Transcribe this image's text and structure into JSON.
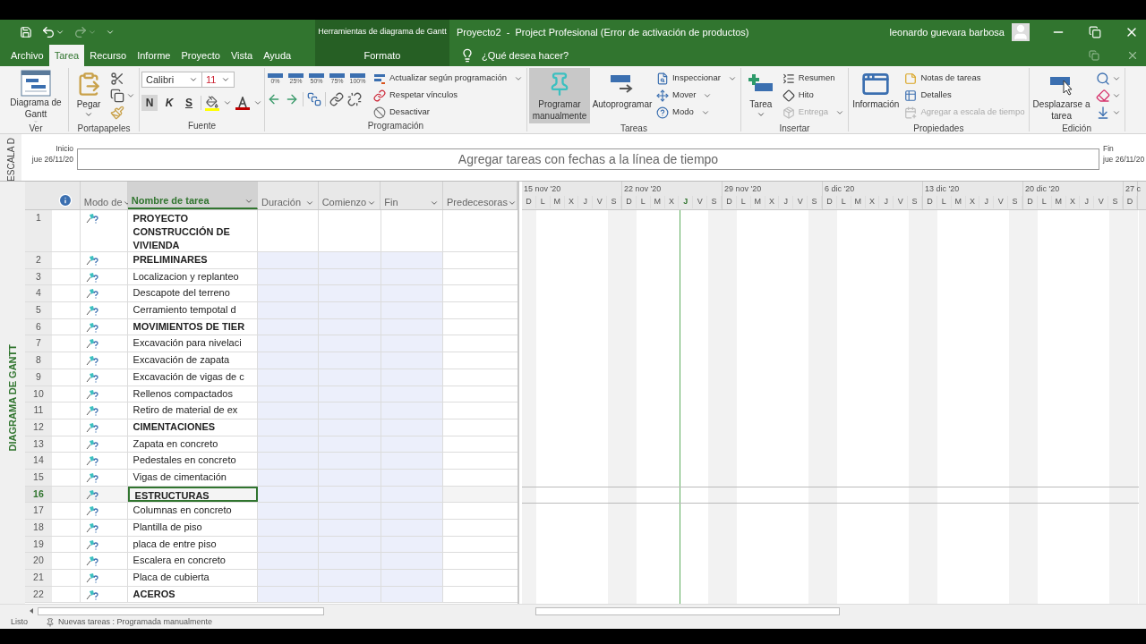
{
  "title_bar": {
    "context_group": "Herramientas de diagrama de Gantt",
    "title": "Proyecto2  -  Project Profesional (Error de activación de productos)",
    "user": "leonardo guevara barbosa"
  },
  "tabs": [
    {
      "label": "Archivo",
      "selected": false,
      "kind": "normal"
    },
    {
      "label": "Tarea",
      "selected": true,
      "kind": "normal"
    },
    {
      "label": "Recurso",
      "selected": false,
      "kind": "normal"
    },
    {
      "label": "Informe",
      "selected": false,
      "kind": "normal"
    },
    {
      "label": "Proyecto",
      "selected": false,
      "kind": "normal"
    },
    {
      "label": "Vista",
      "selected": false,
      "kind": "normal"
    },
    {
      "label": "Ayuda",
      "selected": false,
      "kind": "normal"
    },
    {
      "label": "Formato",
      "selected": false,
      "kind": "contextual"
    }
  ],
  "tell_me": {
    "placeholder": "¿Qué desea hacer?"
  },
  "ribbon_groups": [
    {
      "label": "Ver",
      "items": [
        {
          "kind": "large",
          "label": "Diagrama de Gantt",
          "dropdown": true,
          "selected": false,
          "disabled": false
        }
      ]
    },
    {
      "label": "Portapapeles",
      "items": [
        {
          "kind": "large",
          "label": "Pegar",
          "dropdown": true,
          "selected": false,
          "disabled": false
        },
        {
          "kind": "icon",
          "dropdown": false,
          "disabled": false
        },
        {
          "kind": "icon",
          "dropdown": true,
          "disabled": false
        },
        {
          "kind": "icon",
          "dropdown": false,
          "disabled": false
        }
      ]
    },
    {
      "label": "Fuente",
      "items": [
        {
          "kind": "font",
          "font": "Calibri",
          "size": "11",
          "bold": "N",
          "italic": "K",
          "underline": "S"
        }
      ]
    },
    {
      "label": "Programación",
      "items": [
        {
          "kind": "percents",
          "labels": [
            "0%",
            "25%",
            "50%",
            "75%",
            "100%"
          ]
        },
        {
          "kind": "small",
          "label": "Actualizar según programación",
          "dropdown": true,
          "disabled": false
        },
        {
          "kind": "small",
          "label": "Respetar vínculos",
          "dropdown": false,
          "disabled": false
        },
        {
          "kind": "small",
          "label": "Desactivar",
          "dropdown": false,
          "disabled": false
        }
      ]
    },
    {
      "label": "Tareas",
      "items": [
        {
          "kind": "large",
          "label": "Programar manualmente",
          "dropdown": false,
          "selected": true,
          "disabled": false
        },
        {
          "kind": "large",
          "label": "Autoprogramar",
          "dropdown": false,
          "selected": false,
          "disabled": false
        },
        {
          "kind": "small",
          "label": "Inspeccionar",
          "dropdown": true,
          "disabled": false
        },
        {
          "kind": "small",
          "label": "Mover",
          "dropdown": true,
          "disabled": false
        },
        {
          "kind": "small",
          "label": "Modo",
          "dropdown": true,
          "disabled": false
        }
      ]
    },
    {
      "label": "Insertar",
      "items": [
        {
          "kind": "large",
          "label": "Tarea",
          "dropdown": true,
          "selected": false,
          "disabled": false
        },
        {
          "kind": "small",
          "label": "Resumen",
          "dropdown": false,
          "disabled": false
        },
        {
          "kind": "small",
          "label": "Hito",
          "dropdown": false,
          "disabled": false
        },
        {
          "kind": "small",
          "label": "Entrega",
          "dropdown": true,
          "disabled": true
        }
      ]
    },
    {
      "label": "Propiedades",
      "items": [
        {
          "kind": "large",
          "label": "Información",
          "dropdown": false,
          "selected": false,
          "disabled": false
        },
        {
          "kind": "small",
          "label": "Notas de tareas",
          "dropdown": false,
          "disabled": false
        },
        {
          "kind": "small",
          "label": "Detalles",
          "dropdown": false,
          "disabled": false
        },
        {
          "kind": "small",
          "label": "Agregar a escala de tiempo",
          "dropdown": false,
          "disabled": true
        }
      ]
    },
    {
      "label": "Edición",
      "items": [
        {
          "kind": "large",
          "label": "Desplazarse a tarea",
          "dropdown": false,
          "selected": false,
          "disabled": false
        },
        {
          "kind": "icon",
          "dropdown": true,
          "disabled": false
        },
        {
          "kind": "icon",
          "dropdown": true,
          "disabled": false
        },
        {
          "kind": "icon",
          "dropdown": true,
          "disabled": false
        }
      ]
    }
  ],
  "timeline": {
    "side_label": "ESCALA D",
    "start_label": "Inicio",
    "start_date": "jue 26/11/20",
    "placeholder": "Agregar tareas con fechas a la línea de tiempo",
    "end_label": "Fin",
    "end_date": "jue 26/11/20"
  },
  "view_label": "DIAGRAMA DE GANTT",
  "table": {
    "columns": [
      {
        "kind": "info",
        "selected": false
      },
      {
        "kind": "text",
        "label": "Modo de",
        "selected": false
      },
      {
        "kind": "text",
        "label": "Nombre de tarea",
        "selected": true
      },
      {
        "kind": "text",
        "label": "Duración",
        "selected": false
      },
      {
        "kind": "text",
        "label": "Comienzo",
        "selected": false
      },
      {
        "kind": "text",
        "label": "Fin",
        "selected": false
      },
      {
        "kind": "text",
        "label": "Predecesoras",
        "selected": false
      }
    ],
    "rows": [
      {
        "id": "1",
        "name": "PROYECTO CONSTRUCCIÓN DE VIVIENDA",
        "kind": "summary",
        "shaded": false,
        "selected": false
      },
      {
        "id": "2",
        "name": "PRELIMINARES",
        "kind": "summary",
        "shaded": true,
        "selected": false
      },
      {
        "id": "3",
        "name": "Localizacion y replanteo",
        "kind": "task",
        "shaded": true,
        "selected": false
      },
      {
        "id": "4",
        "name": "Descapote del terreno",
        "kind": "task",
        "shaded": true,
        "selected": false
      },
      {
        "id": "5",
        "name": "Cerramiento tempotal d",
        "kind": "task",
        "shaded": true,
        "selected": false
      },
      {
        "id": "6",
        "name": "MOVIMIENTOS DE TIER",
        "kind": "summary",
        "shaded": true,
        "selected": false
      },
      {
        "id": "7",
        "name": "Excavación para nivelaci",
        "kind": "task",
        "shaded": true,
        "selected": false
      },
      {
        "id": "8",
        "name": "Excavación de zapata",
        "kind": "task",
        "shaded": true,
        "selected": false
      },
      {
        "id": "9",
        "name": "Excavación de vigas de c",
        "kind": "task",
        "shaded": true,
        "selected": false
      },
      {
        "id": "10",
        "name": "Rellenos compactados",
        "kind": "task",
        "shaded": true,
        "selected": false
      },
      {
        "id": "11",
        "name": "Retiro de material de ex",
        "kind": "task",
        "shaded": true,
        "selected": false
      },
      {
        "id": "12",
        "name": "CIMENTACIONES",
        "kind": "summary",
        "shaded": true,
        "selected": false
      },
      {
        "id": "13",
        "name": "Zapata en concreto",
        "kind": "task",
        "shaded": true,
        "selected": false
      },
      {
        "id": "14",
        "name": "Pedestales en concreto",
        "kind": "task",
        "shaded": true,
        "selected": false
      },
      {
        "id": "15",
        "name": "Vigas de cimentación",
        "kind": "task",
        "shaded": true,
        "selected": false
      },
      {
        "id": "16",
        "name": "ESTRUCTURAS",
        "kind": "summary",
        "shaded": true,
        "selected": true
      },
      {
        "id": "17",
        "name": "Columnas en concreto",
        "kind": "task",
        "shaded": true,
        "selected": false
      },
      {
        "id": "18",
        "name": "Plantilla de piso",
        "kind": "task",
        "shaded": true,
        "selected": false
      },
      {
        "id": "19",
        "name": "placa de entre piso",
        "kind": "task",
        "shaded": true,
        "selected": false
      },
      {
        "id": "20",
        "name": "Escalera en concreto",
        "kind": "task",
        "shaded": true,
        "selected": false
      },
      {
        "id": "21",
        "name": "Placa de cubierta",
        "kind": "task",
        "shaded": true,
        "selected": false
      },
      {
        "id": "22",
        "name": "ACEROS",
        "kind": "summary",
        "shaded": true,
        "selected": false
      }
    ]
  },
  "gantt": {
    "weeks": [
      {
        "label": "15 nov '20",
        "days": [
          {
            "d": "D",
            "today": false
          },
          {
            "d": "L",
            "today": false
          },
          {
            "d": "M",
            "today": false
          },
          {
            "d": "X",
            "today": false
          },
          {
            "d": "J",
            "today": false
          },
          {
            "d": "V",
            "today": false
          },
          {
            "d": "S",
            "today": false
          }
        ]
      },
      {
        "label": "22 nov '20",
        "days": [
          {
            "d": "D",
            "today": false
          },
          {
            "d": "L",
            "today": false
          },
          {
            "d": "M",
            "today": false
          },
          {
            "d": "X",
            "today": false
          },
          {
            "d": "J",
            "today": true
          },
          {
            "d": "V",
            "today": false
          },
          {
            "d": "S",
            "today": false
          }
        ]
      },
      {
        "label": "29 nov '20",
        "days": [
          {
            "d": "D",
            "today": false
          },
          {
            "d": "L",
            "today": false
          },
          {
            "d": "M",
            "today": false
          },
          {
            "d": "X",
            "today": false
          },
          {
            "d": "J",
            "today": false
          },
          {
            "d": "V",
            "today": false
          },
          {
            "d": "S",
            "today": false
          }
        ]
      },
      {
        "label": "6 dic '20",
        "days": [
          {
            "d": "D",
            "today": false
          },
          {
            "d": "L",
            "today": false
          },
          {
            "d": "M",
            "today": false
          },
          {
            "d": "X",
            "today": false
          },
          {
            "d": "J",
            "today": false
          },
          {
            "d": "V",
            "today": false
          },
          {
            "d": "S",
            "today": false
          }
        ]
      },
      {
        "label": "13 dic '20",
        "days": [
          {
            "d": "D",
            "today": false
          },
          {
            "d": "L",
            "today": false
          },
          {
            "d": "M",
            "today": false
          },
          {
            "d": "X",
            "today": false
          },
          {
            "d": "J",
            "today": false
          },
          {
            "d": "V",
            "today": false
          },
          {
            "d": "S",
            "today": false
          }
        ]
      },
      {
        "label": "20 dic '20",
        "days": [
          {
            "d": "D",
            "today": false
          },
          {
            "d": "L",
            "today": false
          },
          {
            "d": "M",
            "today": false
          },
          {
            "d": "X",
            "today": false
          },
          {
            "d": "J",
            "today": false
          },
          {
            "d": "V",
            "today": false
          },
          {
            "d": "S",
            "today": false
          }
        ]
      },
      {
        "label": "27 c",
        "days": [
          {
            "d": "D",
            "today": false
          }
        ]
      }
    ]
  },
  "status_bar": {
    "ready": "Listo",
    "new_tasks": "Nuevas tareas : Programada manualmente"
  }
}
